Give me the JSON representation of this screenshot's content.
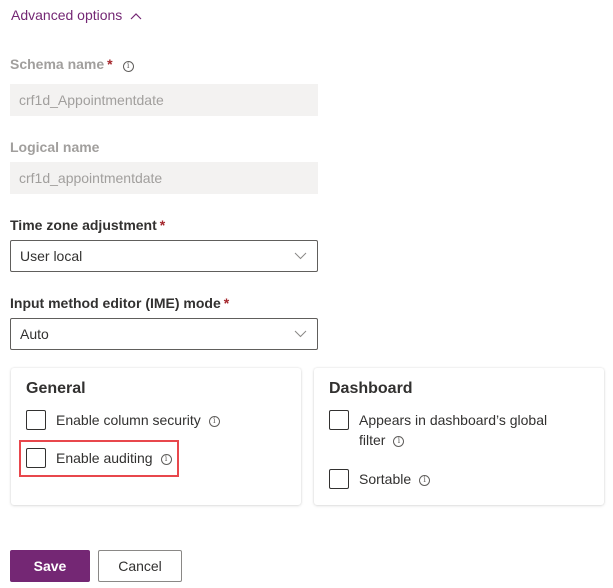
{
  "advanced_toggle": {
    "label": "Advanced options",
    "icon": "chevron-up-icon",
    "expanded": true
  },
  "fields": {
    "schema_name": {
      "label": "Schema name",
      "required": true,
      "has_info": true,
      "value": "crf1d_Appointmentdate",
      "disabled": true
    },
    "logical_name": {
      "label": "Logical name",
      "required": false,
      "value": "crf1d_appointmentdate",
      "disabled": true
    },
    "time_zone": {
      "label": "Time zone adjustment",
      "required": true,
      "value": "User local"
    },
    "ime_mode": {
      "label": "Input method editor (IME) mode",
      "required": true,
      "value": "Auto"
    }
  },
  "required_marker": "*",
  "info_glyph": "i",
  "general": {
    "title": "General",
    "options": [
      {
        "label": "Enable column security",
        "checked": false,
        "has_info": true
      },
      {
        "label": "Enable auditing",
        "checked": false,
        "has_info": true,
        "highlighted": true
      }
    ]
  },
  "dashboard": {
    "title": "Dashboard",
    "options": [
      {
        "label": "Appears in dashboard’s global filter",
        "line1": "Appears in dashboard’s global",
        "line2": "filter",
        "checked": false,
        "has_info": true
      },
      {
        "label": "Sortable",
        "checked": false,
        "has_info": true
      }
    ]
  },
  "buttons": {
    "save": "Save",
    "cancel": "Cancel"
  },
  "colors": {
    "accent": "#742774",
    "required": "#a4262c",
    "highlight": "#e8474c"
  }
}
